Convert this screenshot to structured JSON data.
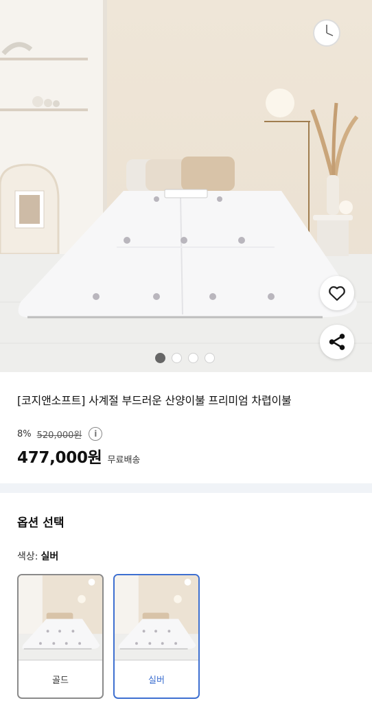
{
  "product": {
    "title": "[코지앤소프트] 사계절 부드러운 산양이불 프리미엄 차렵이불",
    "discount": "8%",
    "original_price": "520,000원",
    "price": "477,000원",
    "shipping": "무료배송",
    "info_icon": "info-icon"
  },
  "gallery": {
    "image_count": 4,
    "active_index": 0,
    "like_icon": "heart-icon",
    "share_icon": "share-icon"
  },
  "options": {
    "section_title": "옵션 선택",
    "color_label": "색상:",
    "color_selected": "실버",
    "choices": [
      {
        "label": "골드",
        "selected": false
      },
      {
        "label": "실버",
        "selected": true
      }
    ]
  },
  "colors": {
    "accent": "#3d6fd0",
    "divider_bg": "#f0f3f7",
    "wall": "#ece2d3"
  }
}
